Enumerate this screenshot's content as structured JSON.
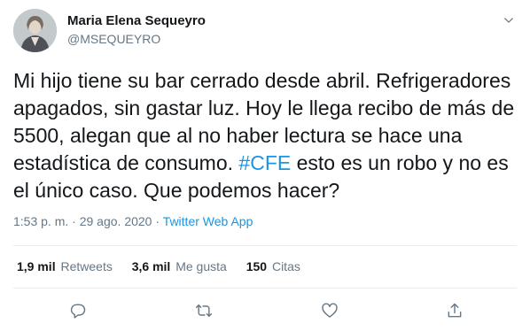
{
  "author": {
    "name": "Maria Elena Sequeyro",
    "handle": "@MSEQUEYRO",
    "avatar_icon": "profile-photo"
  },
  "tweet": {
    "text_before": "Mi hijo tiene su bar cerrado desde abril. Refrigeradores apagados, sin gastar luz. Hoy le llega recibo de más de 5500, alegan que al no haber lectura se hace una estadística de consumo. ",
    "hashtag": "#CFE",
    "text_after": " esto es un robo y no es el único caso. Que podemos hacer?"
  },
  "meta": {
    "time": "1:53 p. m.",
    "separator": "·",
    "date": "29 ago. 2020",
    "source": "Twitter Web App"
  },
  "stats": {
    "retweets_count": "1,9 mil",
    "retweets_label": "Retweets",
    "likes_count": "3,6 mil",
    "likes_label": "Me gusta",
    "quotes_count": "150",
    "quotes_label": "Citas"
  },
  "colors": {
    "link": "#1b95e0",
    "secondary_text": "#657786",
    "primary_text": "#14171a",
    "divider": "#e6ecf0"
  },
  "actions": [
    "reply-icon",
    "retweet-icon",
    "like-icon",
    "share-icon"
  ]
}
